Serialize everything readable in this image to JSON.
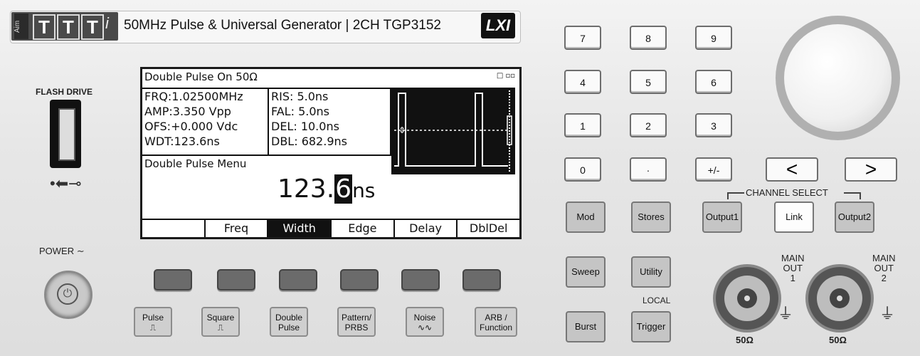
{
  "header": {
    "logo_aim": "Aim",
    "logo_letters": [
      "T",
      "T",
      "T"
    ],
    "logo_i": "i",
    "model_title": "50MHz Pulse & Universal Generator | 2CH   TGP3152",
    "lxi_badge": "LXI"
  },
  "left_panel": {
    "flash_drive_label": "FLASH DRIVE",
    "usb_symbol": "•⬅⊸",
    "power_label": "POWER ∼",
    "power_icon": "⏻"
  },
  "display": {
    "title": "Double Pulse On 50Ω",
    "corner_icon": "□ ▫▫",
    "params_left": [
      "FRQ:1.02500MHz",
      "AMP:3.350 Vpp",
      "OFS:+0.000 Vdc",
      "WDT:123.6ns"
    ],
    "params_mid": [
      "RIS:  5.0ns",
      "FAL: 5.0ns",
      "DEL: 10.0ns",
      "DBL: 682.9ns"
    ],
    "menu_title": "Double Pulse Menu",
    "value_main": "123.",
    "value_cursor_digit": "6",
    "value_unit": "ns",
    "softkeys": [
      {
        "label": "",
        "active": false
      },
      {
        "label": "Freq",
        "active": false
      },
      {
        "label": "Width",
        "active": true
      },
      {
        "label": "Edge",
        "active": false
      },
      {
        "label": "Delay",
        "active": false
      },
      {
        "label": "DblDel",
        "active": false
      }
    ]
  },
  "waveform_buttons": {
    "pulse": "Pulse",
    "square": "Square",
    "double_pulse": "Double\nPulse",
    "pattern_prbs": "Pattern/\nPRBS",
    "noise": "Noise",
    "arb_function": "ARB /\nFunction",
    "pulse_glyph": "⎍",
    "square_glyph": "⎍",
    "noise_glyph": "∿∿"
  },
  "keypad": {
    "k7": "7",
    "k8": "8",
    "k9": "9",
    "k4": "4",
    "k5": "5",
    "k6": "6",
    "k1": "1",
    "k2": "2",
    "k3": "3",
    "k0": "0",
    "kdot": "·",
    "kpm": "+/-",
    "left": "<",
    "right": ">"
  },
  "function_keys": {
    "mod": "Mod",
    "stores": "Stores",
    "sweep": "Sweep",
    "utility": "Utility",
    "burst": "Burst",
    "trigger": "Trigger",
    "local_label": "LOCAL"
  },
  "channel_select": {
    "label": "CHANNEL SELECT",
    "output1": "Output1",
    "link": "Link",
    "output2": "Output2"
  },
  "outputs": {
    "main_out_1": "MAIN\nOUT\n1",
    "main_out_2": "MAIN\nOUT\n2",
    "impedance_1": "50Ω",
    "impedance_2": "50Ω",
    "ground_symbol": "⏚"
  }
}
